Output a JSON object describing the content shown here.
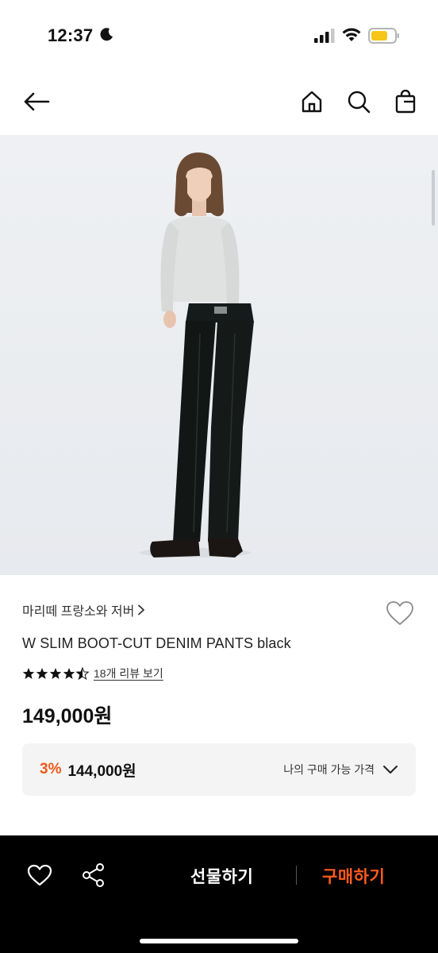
{
  "status_bar": {
    "time": "12:37",
    "icons": [
      "moon-icon",
      "signal-icon",
      "wifi-icon",
      "battery-icon"
    ],
    "battery_color": "#f5c518"
  },
  "nav": {
    "icons": [
      "back-arrow-icon",
      "home-icon",
      "search-icon",
      "shopping-bag-icon"
    ]
  },
  "product": {
    "brand": "마리떼 프랑소와 저버",
    "name": "W SLIM BOOT-CUT DENIM PANTS black",
    "rating": 4.5,
    "rating_max": 5,
    "review_link": "18개 리뷰 보기",
    "price": "149,000원",
    "discount": {
      "rate": "3%",
      "price": "144,000원",
      "my_price_label": "나의 구매 가능 가격"
    }
  },
  "bottom_bar": {
    "gift_label": "선물하기",
    "buy_label": "구매하기",
    "icons": [
      "heart-icon",
      "share-icon"
    ]
  },
  "colors": {
    "accent": "#ff5a1f",
    "discount": "#f05a1a",
    "bottom_bg": "#000000"
  }
}
